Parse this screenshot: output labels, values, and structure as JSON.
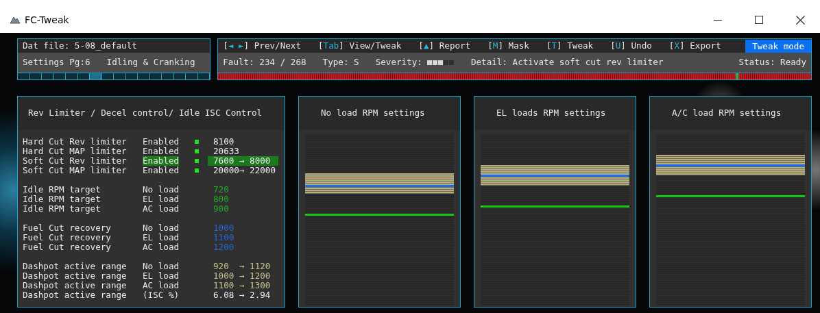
{
  "window": {
    "title": "FC-Tweak"
  },
  "file_panel": {
    "dat_file": "Dat file: 5-08_default",
    "settings_page": "Settings Pg:6",
    "section": "Idling & Cranking",
    "pages": [
      {
        "selected": false
      },
      {
        "selected": false
      },
      {
        "selected": false
      },
      {
        "selected": false
      },
      {
        "selected": false
      },
      {
        "selected": false
      },
      {
        "selected": true
      },
      {
        "selected": false
      },
      {
        "selected": false
      },
      {
        "selected": false
      },
      {
        "selected": false
      },
      {
        "selected": false
      },
      {
        "selected": false
      },
      {
        "selected": false
      },
      {
        "selected": false
      },
      {
        "selected": false
      }
    ]
  },
  "shortcuts": [
    {
      "key": "[◄ ►]",
      "label": "Prev/Next"
    },
    {
      "key": "[Tab]",
      "label": "View/Tweak"
    },
    {
      "key": "[▲]",
      "label": "Report"
    },
    {
      "key": "[M]",
      "label": "Mask"
    },
    {
      "key": "[T]",
      "label": "Tweak"
    },
    {
      "key": "[U]",
      "label": "Undo"
    },
    {
      "key": "[X]",
      "label": "Export"
    }
  ],
  "mode": "Tweak mode",
  "status_bar": {
    "fault": "Fault: 234 / 268",
    "type": "Type: S",
    "severity_label": "Severity:",
    "severity": {
      "level": 0.6
    },
    "detail": "Detail: Activate soft cut rev limiter",
    "status": "Status: Ready",
    "fault_position": {
      "level": 0.873
    }
  },
  "settings_panel": {
    "title": "Rev Limiter / Decel control/ Idle ISC Control",
    "groups": [
      {
        "rows": [
          {
            "label": "Hard Cut Rev limiter",
            "mode": "Enabled",
            "enabled": true,
            "value": "8100",
            "selected": false
          },
          {
            "label": "Hard Cut MAP limiter",
            "mode": "Enabled",
            "enabled": true,
            "value": "20633",
            "selected": false
          },
          {
            "label": "Soft Cut Rev limiter",
            "mode": "Enabled",
            "enabled": true,
            "value": "7600 → 8000",
            "selected": true
          },
          {
            "label": "Soft Cut MAP limiter",
            "mode": "Enabled",
            "enabled": true,
            "value": "20000→ 22000",
            "selected": false
          }
        ]
      },
      {
        "rows": [
          {
            "label": "Idle RPM target",
            "mode": "No load",
            "value": "720",
            "color": "#22aa22",
            "selected": false
          },
          {
            "label": "Idle RPM target",
            "mode": "EL load",
            "value": "800",
            "color": "#22aa22",
            "selected": false
          },
          {
            "label": "Idle RPM target",
            "mode": "AC load",
            "value": "900",
            "color": "#22aa22",
            "selected": false
          }
        ]
      },
      {
        "rows": [
          {
            "label": "Fuel Cut recovery",
            "mode": "No load",
            "value": "1000",
            "color": "#2266dd",
            "selected": false
          },
          {
            "label": "Fuel Cut recovery",
            "mode": "EL load",
            "value": "1100",
            "color": "#2266dd",
            "selected": false
          },
          {
            "label": "Fuel Cut recovery",
            "mode": "AC load",
            "value": "1200",
            "color": "#2266dd",
            "selected": false
          }
        ]
      },
      {
        "rows": [
          {
            "label": "Dashpot active range",
            "mode": "No load",
            "value": "920  → 1120",
            "color": "#c8c48c",
            "selected": false
          },
          {
            "label": "Dashpot active range",
            "mode": "EL load",
            "value": "1000 → 1200",
            "color": "#c8c48c",
            "selected": false
          },
          {
            "label": "Dashpot active range",
            "mode": "AC load",
            "value": "1100 → 1300",
            "color": "#c8c48c",
            "selected": false
          },
          {
            "label": "Dashpot active range",
            "mode": "(ISC %)",
            "value": "6.08 → 2.94",
            "selected": false
          }
        ]
      }
    ]
  },
  "rpm_panels": [
    {
      "title": "No load RPM settings"
    },
    {
      "title": "EL loads RPM settings"
    },
    {
      "title": "A/C load RPM settings"
    }
  ]
}
